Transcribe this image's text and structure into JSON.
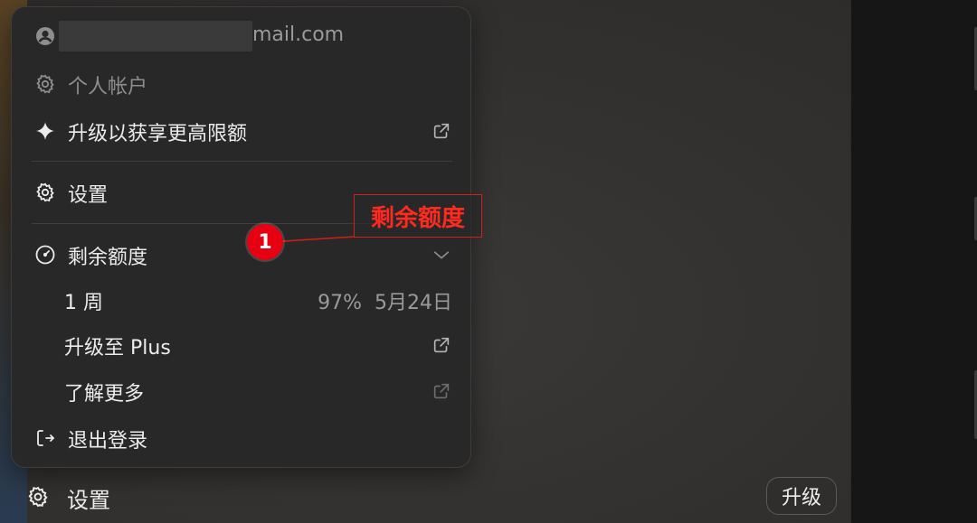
{
  "menu": {
    "email_suffix": "mail.com",
    "items": {
      "personal_account": "个人帐户",
      "upgrade_limits": "升级以获享更高限额",
      "settings": "设置",
      "remaining_quota": "剩余额度",
      "week": "1 周",
      "week_percent": "97%",
      "week_reset": "5月24日",
      "upgrade_plus": "升级至 Plus",
      "learn_more": "了解更多",
      "logout": "退出登录"
    }
  },
  "bottom_bar": {
    "settings_label": "设置",
    "upgrade_label": "升级"
  },
  "annotation": {
    "badge_number": "1",
    "box_text": "剩余额度",
    "color": "#e60012"
  },
  "icons": {
    "account": "user-circle-icon",
    "personal": "gear-icon",
    "upgrade": "sparkle-icon",
    "settings": "gear-icon",
    "quota": "gauge-icon",
    "expand": "chevron-down-icon",
    "external": "external-link-icon",
    "logout": "logout-icon"
  }
}
